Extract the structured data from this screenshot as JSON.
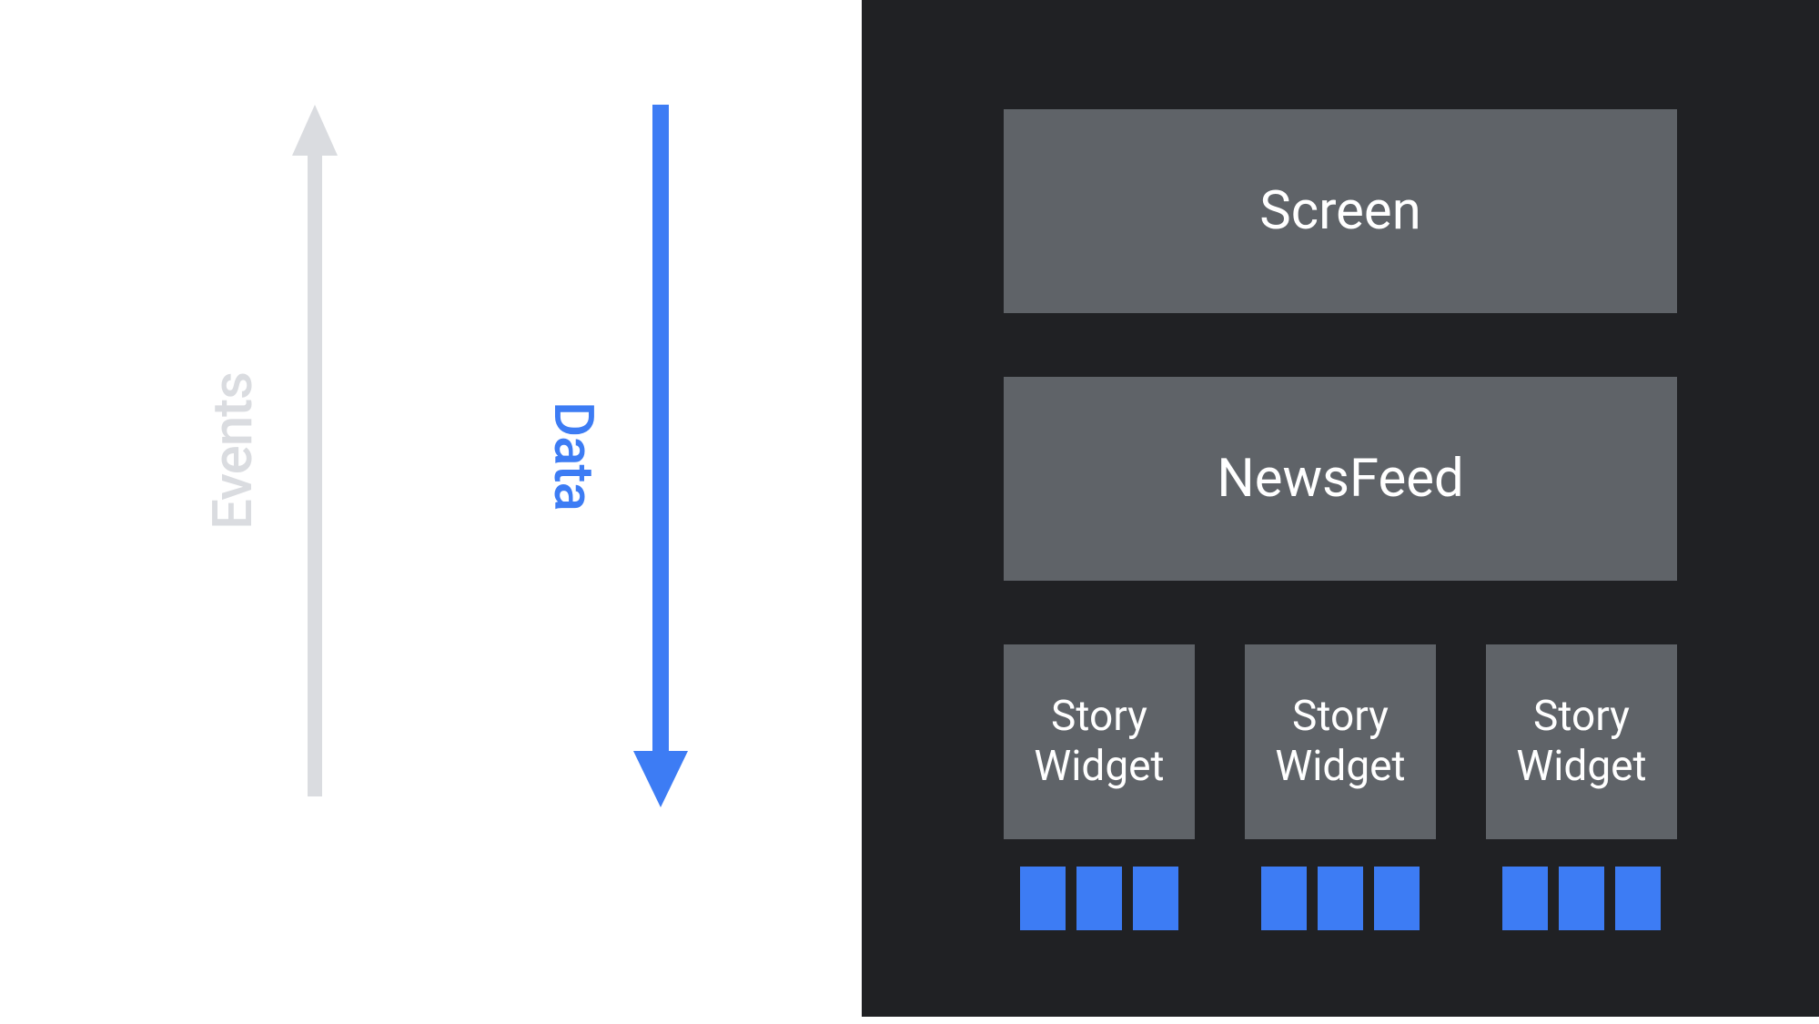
{
  "left": {
    "events_label": "Events",
    "data_label": "Data"
  },
  "right": {
    "screen_label": "Screen",
    "newsfeed_label": "NewsFeed",
    "widgets": [
      {
        "label": "Story\nWidget",
        "chip_count": 3
      },
      {
        "label": "Story\nWidget",
        "chip_count": 3
      },
      {
        "label": "Story\nWidget",
        "chip_count": 3
      }
    ]
  },
  "colors": {
    "accent_blue": "#3d7cf4",
    "light_gray": "#dadce0",
    "box_gray": "#5f6368",
    "dark_bg": "#202124"
  }
}
